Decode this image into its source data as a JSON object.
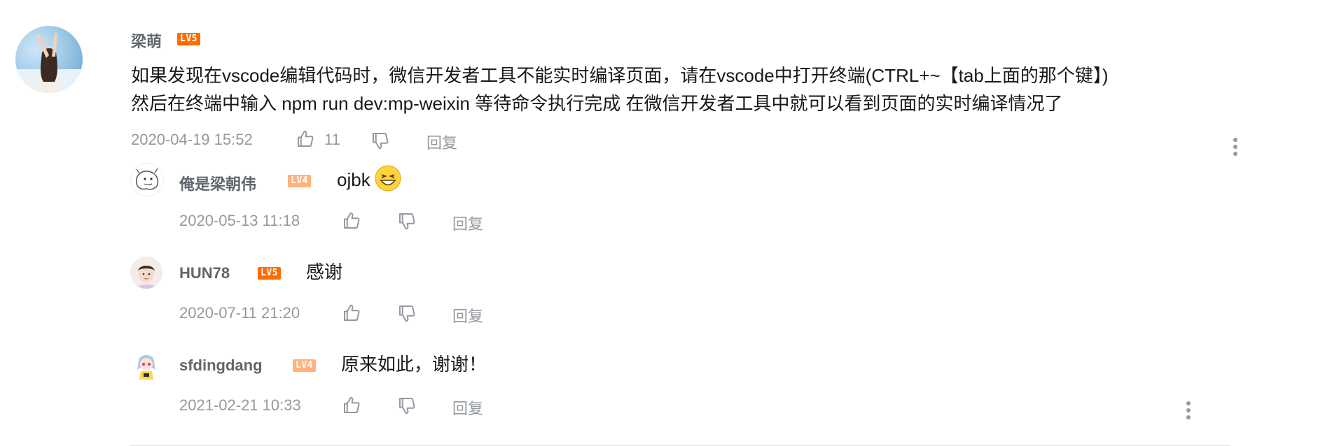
{
  "comment": {
    "username": "梁萌",
    "level": "LV5",
    "content_line1": "如果发现在vscode编辑代码时，微信开发者工具不能实时编译页面，请在vscode中打开终端(CTRL+~【tab上面的那个键】)",
    "content_line2": "然后在终端中输入 npm run dev:mp-weixin  等待命令执行完成 在微信开发者工具中就可以看到页面的实时编译情况了",
    "time": "2020-04-19 15:52",
    "likes": "11",
    "reply_label": "回复"
  },
  "replies": [
    {
      "username": "俺是梁朝伟",
      "level": "LV4",
      "content": "ojbk",
      "time": "2020-05-13 11:18",
      "reply_label": "回复"
    },
    {
      "username": "HUN78",
      "level": "LV5",
      "content": "感谢",
      "time": "2020-07-11 21:20",
      "reply_label": "回复"
    },
    {
      "username": "sfdingdang",
      "level": "LV4",
      "content": "原来如此，谢谢！",
      "time": "2021-02-21 10:33",
      "reply_label": "回复"
    }
  ],
  "colors": {
    "lv5": "#ff6c00",
    "lv4": "#ffb27b",
    "meta": "#9499a0",
    "text": "#18191c"
  },
  "icons": [
    "thumbs-up-icon",
    "thumbs-down-icon",
    "more-vertical-icon",
    "laughing-emoji-icon"
  ]
}
